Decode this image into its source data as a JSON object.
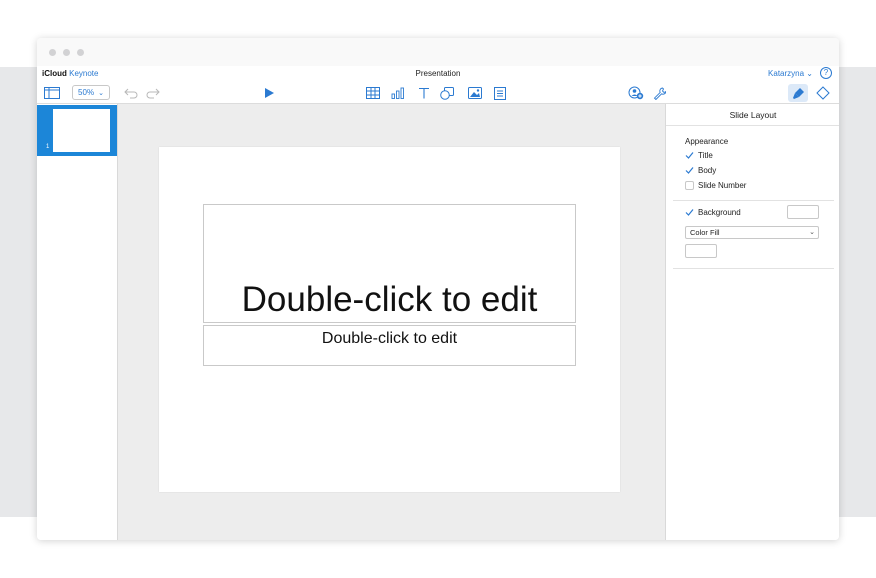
{
  "app": {
    "brand_icloud": "iCloud",
    "brand_app": "Keynote",
    "doc_title": "Presentation",
    "user": "Katarzyna",
    "help": "?"
  },
  "toolbar": {
    "zoom": "50%",
    "icons": [
      "view-icon",
      "undo-icon",
      "redo-icon",
      "play-icon",
      "table-icon",
      "chart-icon",
      "text-icon",
      "shape-icon",
      "media-icon",
      "comment-icon",
      "collaborate-icon",
      "settings-icon",
      "format-icon",
      "animate-icon"
    ]
  },
  "sidebar": {
    "slides": [
      {
        "number": "1",
        "selected": true
      }
    ]
  },
  "slide": {
    "title_placeholder": "Double-click to edit",
    "body_placeholder": "Double-click to edit"
  },
  "panel": {
    "header": "Slide Layout",
    "appearance_label": "Appearance",
    "title_option": {
      "label": "Title",
      "checked": true
    },
    "body_option": {
      "label": "Body",
      "checked": true
    },
    "slide_number_option": {
      "label": "Slide Number",
      "checked": false
    },
    "background_option": {
      "label": "Background",
      "checked": true
    },
    "fill_select": "Color Fill"
  },
  "colors": {
    "accent": "#2b7ad1",
    "selection": "#1c86d8"
  }
}
